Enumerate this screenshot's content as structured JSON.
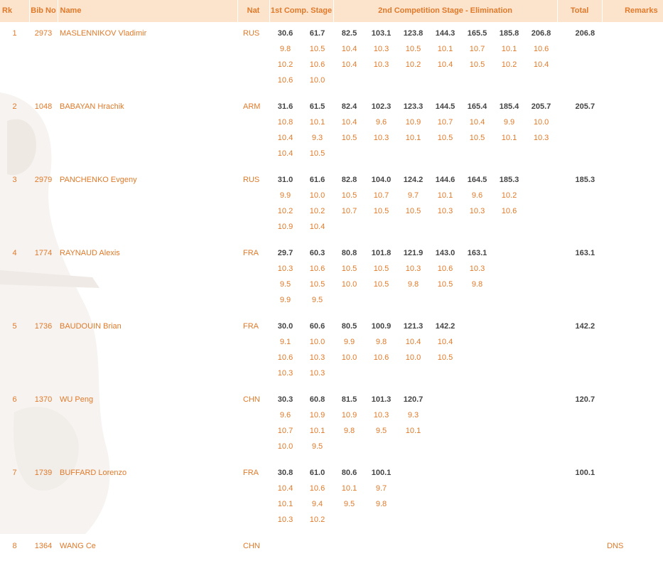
{
  "headers": {
    "rank": "Rk",
    "bib": "Bib No",
    "name": "Name",
    "nat": "Nat",
    "stage1": "1st Comp. Stage",
    "stage2": "2nd Competition Stage - Elimination",
    "total": "Total",
    "remarks": "Remarks"
  },
  "athletes": [
    {
      "rank": "1",
      "bib": "2973",
      "name": "MASLENNIKOV Vladimir",
      "nat": "RUS",
      "cumulative": [
        "30.6",
        "61.7",
        "82.5",
        "103.1",
        "123.8",
        "144.3",
        "165.5",
        "185.8",
        "206.8"
      ],
      "shots": [
        [
          "9.8",
          "10.5",
          "10.4",
          "10.3",
          "10.5",
          "10.1",
          "10.7",
          "10.1",
          "10.6"
        ],
        [
          "10.2",
          "10.6",
          "10.4",
          "10.3",
          "10.2",
          "10.4",
          "10.5",
          "10.2",
          "10.4"
        ],
        [
          "10.6",
          "10.0",
          "",
          "",
          "",
          "",
          "",
          "",
          ""
        ]
      ],
      "total": "206.8",
      "remarks": ""
    },
    {
      "rank": "2",
      "bib": "1048",
      "name": "BABAYAN Hrachik",
      "nat": "ARM",
      "cumulative": [
        "31.6",
        "61.5",
        "82.4",
        "102.3",
        "123.3",
        "144.5",
        "165.4",
        "185.4",
        "205.7"
      ],
      "shots": [
        [
          "10.8",
          "10.1",
          "10.4",
          "9.6",
          "10.9",
          "10.7",
          "10.4",
          "9.9",
          "10.0"
        ],
        [
          "10.4",
          "9.3",
          "10.5",
          "10.3",
          "10.1",
          "10.5",
          "10.5",
          "10.1",
          "10.3"
        ],
        [
          "10.4",
          "10.5",
          "",
          "",
          "",
          "",
          "",
          "",
          ""
        ]
      ],
      "total": "205.7",
      "remarks": ""
    },
    {
      "rank": "3",
      "bib": "2979",
      "name": "PANCHENKO Evgeny",
      "nat": "RUS",
      "cumulative": [
        "31.0",
        "61.6",
        "82.8",
        "104.0",
        "124.2",
        "144.6",
        "164.5",
        "185.3",
        ""
      ],
      "shots": [
        [
          "9.9",
          "10.0",
          "10.5",
          "10.7",
          "9.7",
          "10.1",
          "9.6",
          "10.2",
          ""
        ],
        [
          "10.2",
          "10.2",
          "10.7",
          "10.5",
          "10.5",
          "10.3",
          "10.3",
          "10.6",
          ""
        ],
        [
          "10.9",
          "10.4",
          "",
          "",
          "",
          "",
          "",
          "",
          ""
        ]
      ],
      "total": "185.3",
      "remarks": ""
    },
    {
      "rank": "4",
      "bib": "1774",
      "name": "RAYNAUD Alexis",
      "nat": "FRA",
      "cumulative": [
        "29.7",
        "60.3",
        "80.8",
        "101.8",
        "121.9",
        "143.0",
        "163.1",
        "",
        ""
      ],
      "shots": [
        [
          "10.3",
          "10.6",
          "10.5",
          "10.5",
          "10.3",
          "10.6",
          "10.3",
          "",
          ""
        ],
        [
          "9.5",
          "10.5",
          "10.0",
          "10.5",
          "9.8",
          "10.5",
          "9.8",
          "",
          ""
        ],
        [
          "9.9",
          "9.5",
          "",
          "",
          "",
          "",
          "",
          "",
          ""
        ]
      ],
      "total": "163.1",
      "remarks": ""
    },
    {
      "rank": "5",
      "bib": "1736",
      "name": "BAUDOUIN Brian",
      "nat": "FRA",
      "cumulative": [
        "30.0",
        "60.6",
        "80.5",
        "100.9",
        "121.3",
        "142.2",
        "",
        "",
        ""
      ],
      "shots": [
        [
          "9.1",
          "10.0",
          "9.9",
          "9.8",
          "10.4",
          "10.4",
          "",
          "",
          ""
        ],
        [
          "10.6",
          "10.3",
          "10.0",
          "10.6",
          "10.0",
          "10.5",
          "",
          "",
          ""
        ],
        [
          "10.3",
          "10.3",
          "",
          "",
          "",
          "",
          "",
          "",
          ""
        ]
      ],
      "total": "142.2",
      "remarks": ""
    },
    {
      "rank": "6",
      "bib": "1370",
      "name": "WU Peng",
      "nat": "CHN",
      "cumulative": [
        "30.3",
        "60.8",
        "81.5",
        "101.3",
        "120.7",
        "",
        "",
        "",
        ""
      ],
      "shots": [
        [
          "9.6",
          "10.9",
          "10.9",
          "10.3",
          "9.3",
          "",
          "",
          "",
          ""
        ],
        [
          "10.7",
          "10.1",
          "9.8",
          "9.5",
          "10.1",
          "",
          "",
          "",
          ""
        ],
        [
          "10.0",
          "9.5",
          "",
          "",
          "",
          "",
          "",
          "",
          ""
        ]
      ],
      "total": "120.7",
      "remarks": ""
    },
    {
      "rank": "7",
      "bib": "1739",
      "name": "BUFFARD Lorenzo",
      "nat": "FRA",
      "cumulative": [
        "30.8",
        "61.0",
        "80.6",
        "100.1",
        "",
        "",
        "",
        "",
        ""
      ],
      "shots": [
        [
          "10.4",
          "10.6",
          "10.1",
          "9.7",
          "",
          "",
          "",
          "",
          ""
        ],
        [
          "10.1",
          "9.4",
          "9.5",
          "9.8",
          "",
          "",
          "",
          "",
          ""
        ],
        [
          "10.3",
          "10.2",
          "",
          "",
          "",
          "",
          "",
          "",
          ""
        ]
      ],
      "total": "100.1",
      "remarks": ""
    },
    {
      "rank": "8",
      "bib": "1364",
      "name": "WANG Ce",
      "nat": "CHN",
      "cumulative": [
        "",
        "",
        "",
        "",
        "",
        "",
        "",
        "",
        ""
      ],
      "shots": [],
      "total": "",
      "remarks": "DNS"
    }
  ],
  "colors": {
    "accent": "#e07a2a",
    "header_bg": "#fbe3cc",
    "value_dark": "#444444"
  }
}
